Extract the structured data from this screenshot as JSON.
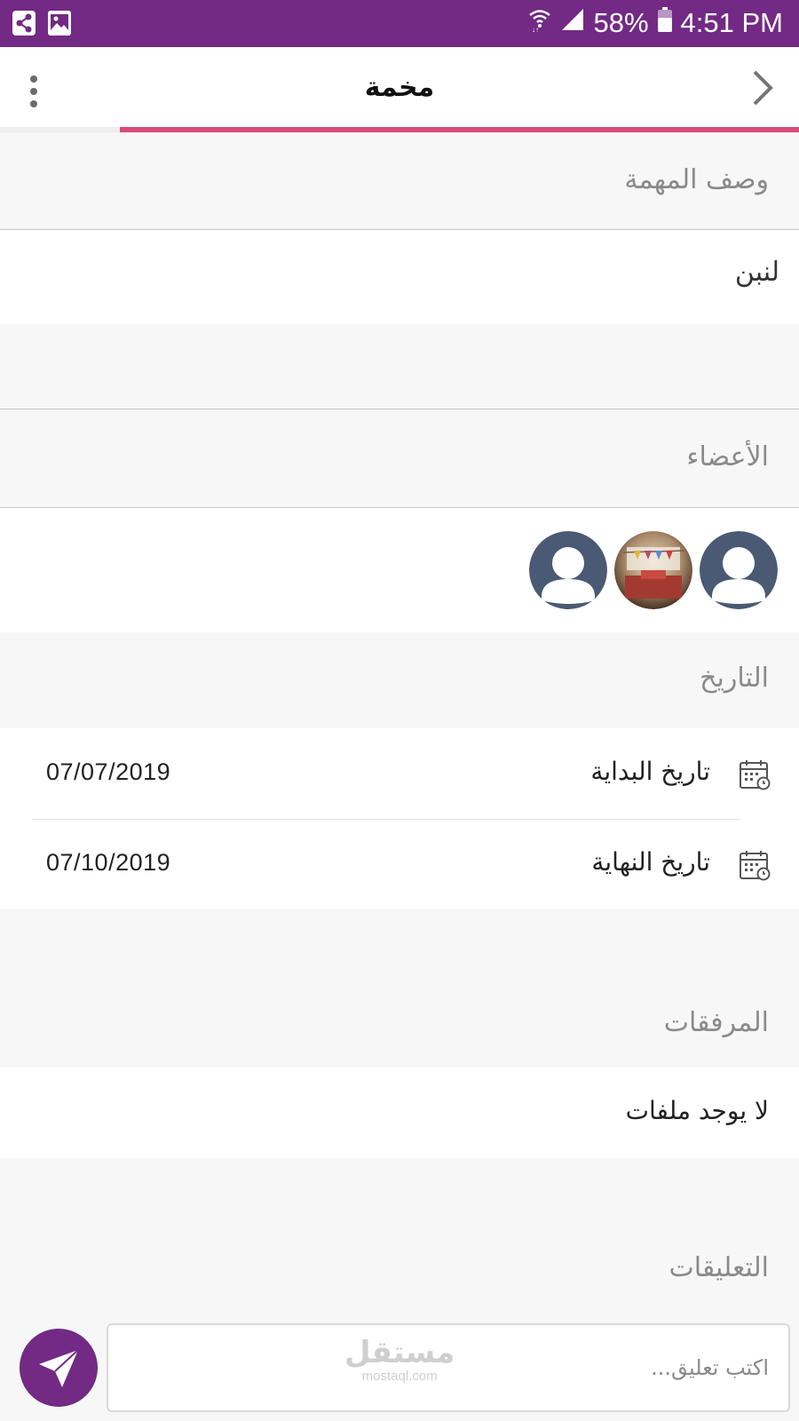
{
  "status_bar": {
    "battery": "58%",
    "time": "4:51 PM",
    "icons": [
      "share-icon",
      "image-icon",
      "wifi-icon",
      "signal-icon",
      "battery-icon"
    ]
  },
  "header": {
    "title": "مخمة",
    "back_icon": "chevron-right-icon",
    "menu_icon": "more-vert-icon",
    "progress_fraction": 0.85
  },
  "description": {
    "heading": "وصف المهمة",
    "text": "لنبن"
  },
  "members": {
    "heading": "الأعضاء",
    "avatars": [
      "default-avatar",
      "photo-avatar",
      "default-avatar"
    ]
  },
  "dates": {
    "heading": "التاريخ",
    "start_label": "تاريخ البداية",
    "start_value": "07/07/2019",
    "end_label": "تاريخ النهاية",
    "end_value": "07/10/2019"
  },
  "attachments": {
    "heading": "المرفقات",
    "empty_text": "لا يوجد ملفات"
  },
  "comments": {
    "heading": "التعليقات",
    "placeholder": "اكتب تعليق...",
    "send_icon": "send-icon"
  },
  "watermark": {
    "arabic": "مستقل",
    "latin": "mostaql.com"
  },
  "colors": {
    "primary": "#722a84",
    "progress": "#d84a7a",
    "avatar_default": "#4a5a74"
  }
}
